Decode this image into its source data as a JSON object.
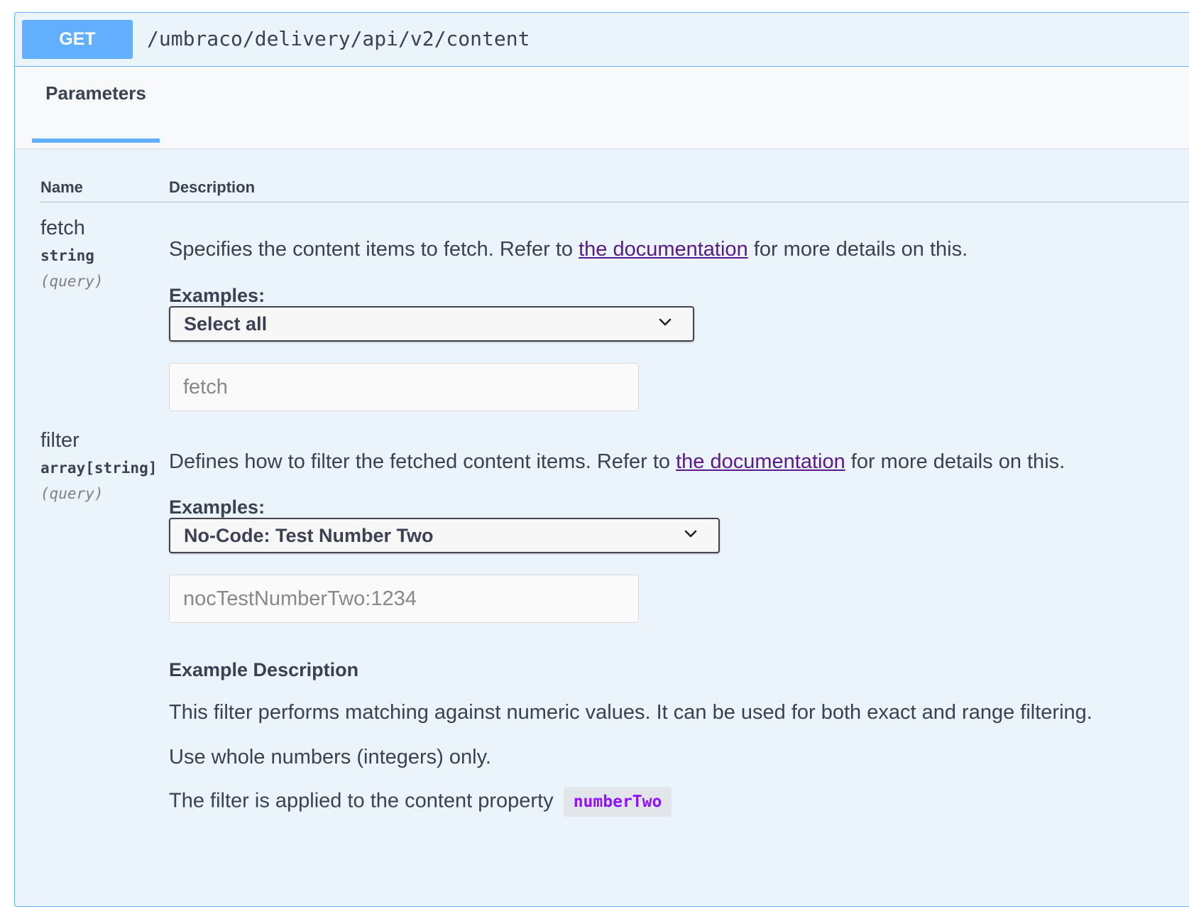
{
  "operation": {
    "method": "GET",
    "path": "/umbraco/delivery/api/v2/content"
  },
  "tabs": {
    "parameters": "Parameters"
  },
  "table": {
    "col_name": "Name",
    "col_description": "Description"
  },
  "params": [
    {
      "name": "fetch",
      "type": "string",
      "in": "(query)",
      "desc_before": "Specifies the content items to fetch. Refer to ",
      "desc_link": "the documentation",
      "desc_after": " for more details on this.",
      "examples_label": "Examples:",
      "selected_example": "Select all",
      "input_placeholder": "fetch"
    },
    {
      "name": "filter",
      "type": "array[string]",
      "in": "(query)",
      "desc_before": "Defines how to filter the fetched content items. Refer to ",
      "desc_link": "the documentation",
      "desc_after": " for more details on this.",
      "examples_label": "Examples:",
      "selected_example": "No-Code: Test Number Two",
      "input_placeholder": "nocTestNumberTwo:1234"
    }
  ],
  "example_description": {
    "title": "Example Description",
    "line1": "This filter performs matching against numeric values. It can be used for both exact and range filtering.",
    "line2": "Use whole numbers (integers) only.",
    "line3": "The filter is applied to the content property ",
    "property": "numberTwo"
  },
  "colors": {
    "get_accent": "#61affe",
    "code_text": "#9012fe",
    "link": "#5a1a8a"
  },
  "icons": {
    "select_chevron": "chevron-down-icon"
  }
}
